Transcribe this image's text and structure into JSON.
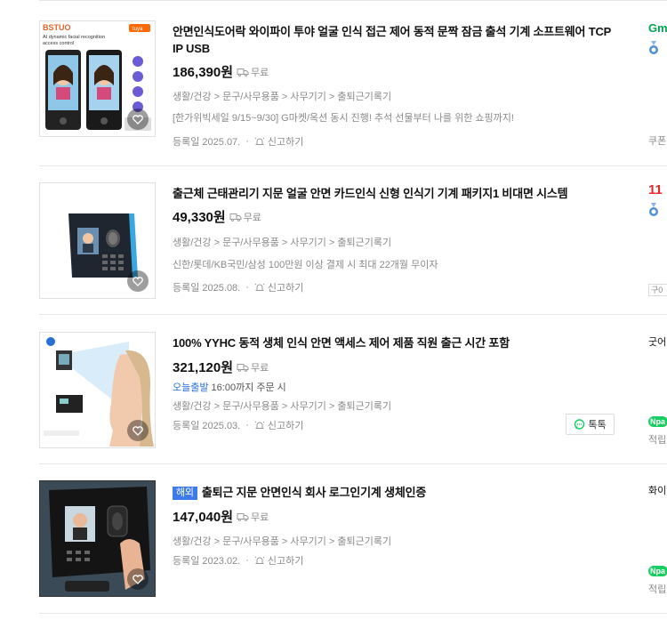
{
  "products": [
    {
      "title": "안면인식도어락 와이파이 투야 얼굴 인식 접근 제어 동적 문짝 잠금 출석 기계 소프트웨어 TCP IP USB",
      "price": "186,390원",
      "shipping": "무료",
      "category": "생활/건강 > 문구/사무용품 > 사무기기 > 출퇴근기록기",
      "promo": "[한가위빅세일 9/15~9/30] G마켓/옥션 동시 진행! 추석 선물부터 나를 위한 쇼핑까지!",
      "date": "등록일 2025.07.",
      "report": "신고하기",
      "thumb_text": {
        "brand": "BSTUO",
        "line1": "AI dynamic facial recognition",
        "line2": "access control",
        "badge": "tuya"
      }
    },
    {
      "title": "출근체 근태관리기 지문 얼굴 안면 카드인식 신형 인식기 기계 패키지1 비대면 시스템",
      "price": "49,330원",
      "shipping": "무료",
      "category": "생활/건강 > 문구/사무용품 > 사무기기 > 출퇴근기록기",
      "promo": "신한/롯데/KB국민/삼성 100만원 이상 결제 시 최대 22개월 무이자",
      "date": "등록일 2025.08.",
      "report": "신고하기"
    },
    {
      "title": "100% YYHC 동적 생체 인식 안면 액세스 제어 제품 직원 출근 시간 포함",
      "price": "321,120원",
      "shipping": "무료",
      "today_label": "오늘출발",
      "today_text": "16:00까지 주문 시",
      "category": "생활/건강 > 문구/사무용품 > 사무기기 > 출퇴근기록기",
      "date": "등록일 2025.03.",
      "report": "신고하기",
      "talk": "톡톡"
    },
    {
      "abroad": "해외",
      "title": "출퇴근 지문 안면인식 회사 로그인기계 생체인증",
      "price": "147,040원",
      "shipping": "무료",
      "category": "생활/건강 > 문구/사무용품 > 사무기기 > 출퇴근기록기",
      "date": "등록일 2023.02.",
      "report": "신고하기"
    }
  ],
  "side": {
    "p1_logo": "Gm",
    "p1_coupon": "쿠폰",
    "p2_num": "11",
    "p2_box": "구0",
    "p3_store": "굿어",
    "p3_npay": "Npa",
    "p3_points": "적립",
    "p4_store": "화이",
    "p4_npay": "Npa",
    "p4_points": "적립"
  },
  "colors": {
    "accent_blue": "#2a6fd6",
    "abroad_badge": "#3e7bea",
    "npay_green": "#19ce60",
    "eleven_red": "#e8262c",
    "gmarket_green": "#00a650"
  },
  "icons": [
    "truck-icon",
    "bell-report-icon",
    "heart-icon",
    "talk-bubble-icon",
    "medal-icon"
  ]
}
